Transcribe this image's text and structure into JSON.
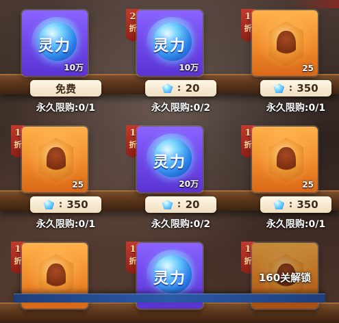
{
  "shop": {
    "items": [
      {
        "type": "orb",
        "rarity": "purple",
        "label": "灵力",
        "qty": "10万",
        "discount_num": "",
        "discount_unit": "",
        "price_type": "free",
        "price": "免费",
        "limit": "永久限购:0/1",
        "locked": false,
        "lock_text": ""
      },
      {
        "type": "orb",
        "rarity": "purple",
        "label": "灵力",
        "qty": "10万",
        "discount_num": "2",
        "discount_unit": "折",
        "price_type": "gem",
        "price": "20",
        "limit": "永久限购:0/2",
        "locked": false,
        "lock_text": ""
      },
      {
        "type": "fragment",
        "rarity": "orange",
        "label": "",
        "qty": "25",
        "discount_num": "1",
        "discount_unit": "折",
        "price_type": "gem",
        "price": "350",
        "limit": "永久限购:0/1",
        "locked": false,
        "lock_text": ""
      },
      {
        "type": "fragment",
        "rarity": "orange",
        "label": "",
        "qty": "25",
        "discount_num": "1",
        "discount_unit": "折",
        "price_type": "gem",
        "price": "350",
        "limit": "永久限购:0/1",
        "locked": false,
        "lock_text": ""
      },
      {
        "type": "orb",
        "rarity": "purple",
        "label": "灵力",
        "qty": "20万",
        "discount_num": "1",
        "discount_unit": "折",
        "price_type": "gem",
        "price": "20",
        "limit": "永久限购:0/2",
        "locked": false,
        "lock_text": ""
      },
      {
        "type": "fragment",
        "rarity": "orange",
        "label": "",
        "qty": "25",
        "discount_num": "1",
        "discount_unit": "折",
        "price_type": "gem",
        "price": "350",
        "limit": "永久限购:0/1",
        "locked": false,
        "lock_text": ""
      },
      {
        "type": "fragment",
        "rarity": "orange",
        "label": "",
        "qty": "",
        "discount_num": "1",
        "discount_unit": "折",
        "price_type": "none",
        "price": "",
        "limit": "",
        "locked": false,
        "lock_text": ""
      },
      {
        "type": "orb",
        "rarity": "purple",
        "label": "灵力",
        "qty": "",
        "discount_num": "1",
        "discount_unit": "折",
        "price_type": "none",
        "price": "",
        "limit": "",
        "locked": false,
        "lock_text": ""
      },
      {
        "type": "fragment",
        "rarity": "orange",
        "label": "",
        "qty": "",
        "discount_num": "1",
        "discount_unit": "折",
        "price_type": "none",
        "price": "",
        "limit": "",
        "locked": true,
        "lock_text": "160关解锁"
      }
    ],
    "icons": {
      "gem": "blue-gem-icon",
      "discount_tag": "discount-ribbon-icon",
      "orb": "spirit-orb-icon",
      "fragment": "hero-fragment-icon"
    }
  }
}
